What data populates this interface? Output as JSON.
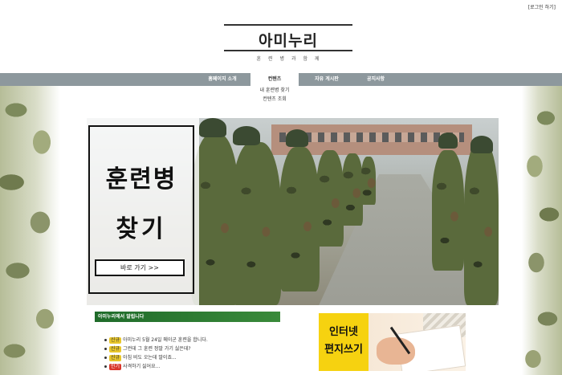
{
  "header": {
    "logout_label": "[로그인 하기]",
    "logo_title": "아미누리",
    "logo_subtitle": "훈련병과함께"
  },
  "nav": {
    "items": [
      {
        "label": "홈페이지 소개"
      },
      {
        "label": "컨텐츠"
      },
      {
        "label": "자유 게시판"
      },
      {
        "label": "공지사항"
      }
    ],
    "dropdown": [
      {
        "label": "내 훈련병 찾기"
      },
      {
        "label": "컨텐츠 조회"
      }
    ]
  },
  "hero": {
    "title_line1": "훈련병",
    "title_line2": "찾기",
    "button_label": "바로 가기 >>"
  },
  "notice": {
    "header": "아미누리에서 알립니다",
    "items": [
      {
        "badge": "신규",
        "text": "아미누리 5월 24일 메이군 훈련을 합니다."
      },
      {
        "badge": "신규",
        "text": "그런데 그 훈련 정말 가기 싫은데?"
      },
      {
        "badge": "신규",
        "text": "아침 비도 오는데 말이죠..."
      },
      {
        "badge": "인기",
        "text": "사격하기 싫어요..."
      }
    ]
  },
  "letter": {
    "line1": "인터넷",
    "line2": "편지쓰기"
  },
  "colors": {
    "navbar": "#8d989d",
    "notice_header": "#1f6b2a",
    "badge_new": "#e8c62a",
    "badge_hot": "#d9372b",
    "letter_yellow": "#f6d210"
  }
}
